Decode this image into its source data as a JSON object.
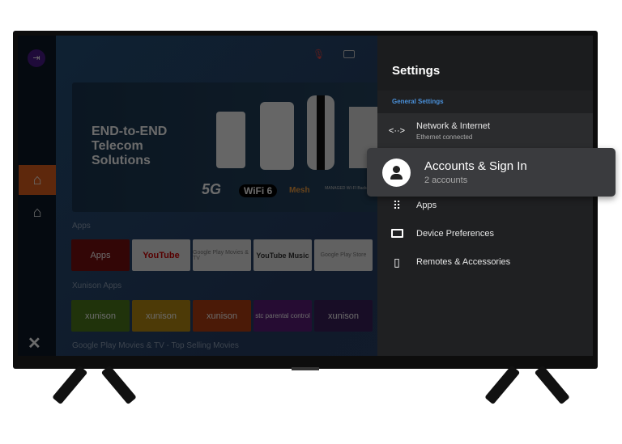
{
  "home": {
    "banner": {
      "line1": "END-to-END",
      "line2": "Telecom",
      "line3": "Solutions",
      "badges": [
        "5G",
        "WiFi 6",
        "Mesh",
        "MANAGED WI-FI Backend"
      ]
    },
    "rows": [
      {
        "title": "Apps",
        "tiles": [
          "Apps",
          "YouTube",
          "Google Play Movies & TV",
          "YouTube Music",
          "Google Play Store"
        ],
        "colors": [
          "#7a0e0e",
          "#e8e8e8",
          "#e8e8e8",
          "#e8e8e8",
          "#e8e8e8"
        ]
      },
      {
        "title": "Xunison Apps",
        "tiles": [
          "xunison",
          "xunison",
          "xunison",
          "stc parental control",
          "xunison"
        ],
        "colors": [
          "#4d7a1a",
          "#b88a10",
          "#b33d10",
          "#5b1d7a",
          "#3a1f5a"
        ]
      },
      {
        "title": "Google Play Movies & TV  -  Top Selling Movies"
      }
    ],
    "sidebar": {
      "active_color": "#e0601c"
    }
  },
  "settings": {
    "title": "Settings",
    "section": "General Settings",
    "section_color": "#4a90d9",
    "items": [
      {
        "label": "Network & Internet",
        "sub": "Ethernet connected",
        "icon": "network-icon"
      },
      {
        "label": "Accounts & Sign In",
        "sub": "2 accounts",
        "icon": "account-icon"
      },
      {
        "label": "Apps",
        "icon": "apps-grid-icon"
      },
      {
        "label": "Device Preferences",
        "icon": "tv-icon"
      },
      {
        "label": "Remotes & Accessories",
        "icon": "remote-icon"
      }
    ]
  }
}
